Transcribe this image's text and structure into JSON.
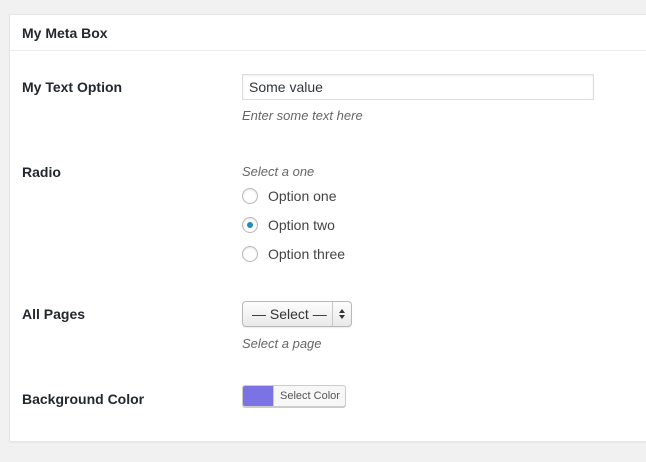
{
  "metabox": {
    "title": "My Meta Box"
  },
  "text_option": {
    "label": "My Text Option",
    "value": "Some value",
    "description": "Enter some text here"
  },
  "radio": {
    "label": "Radio",
    "description": "Select a one",
    "options": [
      {
        "label": "Option one",
        "checked": false
      },
      {
        "label": "Option two",
        "checked": true
      },
      {
        "label": "Option three",
        "checked": false
      }
    ]
  },
  "pages": {
    "label": "All Pages",
    "selected": "— Select —",
    "description": "Select a page"
  },
  "background_color": {
    "label": "Background Color",
    "button_label": "Select Color",
    "value": "#7b73e3"
  },
  "colors": {
    "radio_checked": "#1e8cbe",
    "page_background": "#f1f1f1",
    "panel_background": "#ffffff"
  }
}
